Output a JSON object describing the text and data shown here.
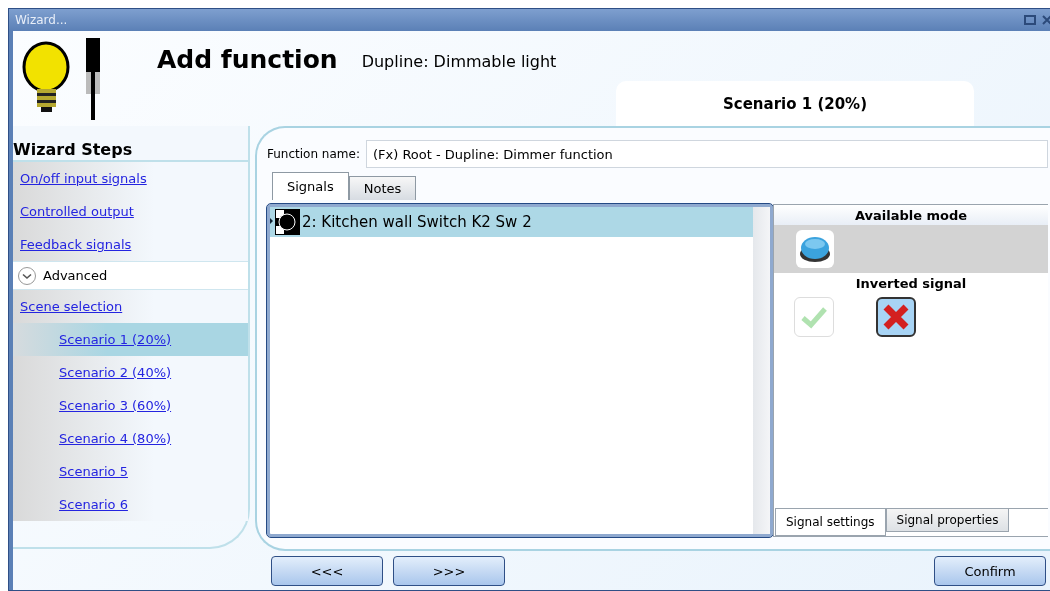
{
  "window": {
    "title": "Wizard..."
  },
  "header": {
    "title": "Add function",
    "subtitle": "Dupline: Dimmable light",
    "scenario_tab": "Scenario 1 (20%)"
  },
  "sidebar": {
    "title": "Wizard Steps",
    "items": [
      {
        "label": "On/off input signals",
        "selected": false
      },
      {
        "label": "Controlled output",
        "selected": false
      },
      {
        "label": "Feedback signals",
        "selected": false
      }
    ],
    "advanced": {
      "label": "Advanced",
      "expanded": true,
      "items": [
        {
          "label": "Scene selection",
          "selected": false,
          "children": [
            {
              "label": "Scenario 1 (20%)",
              "selected": true
            },
            {
              "label": "Scenario 2 (40%)",
              "selected": false
            },
            {
              "label": "Scenario 3 (60%)",
              "selected": false
            },
            {
              "label": "Scenario 4 (80%)",
              "selected": false
            },
            {
              "label": "Scenario 5",
              "selected": false
            },
            {
              "label": "Scenario 6",
              "selected": false
            }
          ]
        }
      ]
    }
  },
  "function_name": {
    "label": "Function name:",
    "value": "(Fx) Root - Dupline: Dimmer function"
  },
  "tabs": [
    {
      "label": "Signals",
      "selected": true
    },
    {
      "label": "Notes",
      "selected": false
    }
  ],
  "signals": [
    {
      "label": "2: Kitchen wall Switch K2 Sw 2",
      "selected": true
    }
  ],
  "settings": {
    "available_mode": "Available mode",
    "inverted_signal": "Inverted signal",
    "inverted_options": [
      {
        "kind": "check",
        "selected": false
      },
      {
        "kind": "cross",
        "selected": true
      }
    ]
  },
  "settings_tabs": [
    {
      "label": "Signal settings",
      "selected": true
    },
    {
      "label": "Signal properties",
      "selected": false
    }
  ],
  "buttons": {
    "back": "<<<",
    "next": ">>>",
    "confirm": "Confirm"
  }
}
